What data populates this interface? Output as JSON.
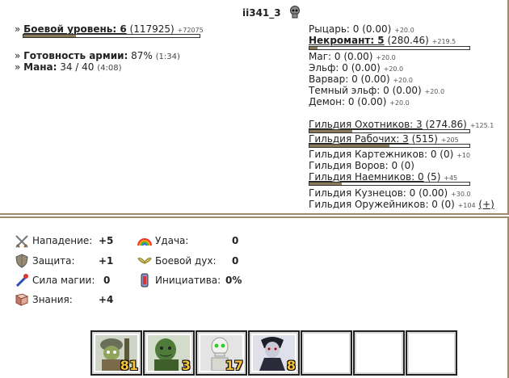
{
  "header": {
    "player_name": "ii341_3"
  },
  "left": {
    "combat_level_label": "Боевой уровень: 6",
    "combat_level_exp": "(117925)",
    "combat_level_gain": "+72075",
    "combat_level_progress": 0.3,
    "army_ready_label": "Готовность армии:",
    "army_ready_value": "87%",
    "army_ready_time": "(1:34)",
    "mana_label": "Мана:",
    "mana_value": "34 / 40",
    "mana_time": "(4:08)"
  },
  "factions": [
    {
      "name": "Рыцарь: 0 (0.00)",
      "gain": "+20.0",
      "bold": false,
      "bar": false
    },
    {
      "name": "Некромант: 5",
      "value": "(280.46)",
      "gain": "+219.5",
      "bold": true,
      "bar": true,
      "progress": 0.05
    },
    {
      "name": "Маг: 0 (0.00)",
      "gain": "+20.0",
      "bold": false,
      "bar": false
    },
    {
      "name": "Эльф: 0 (0.00)",
      "gain": "+20.0",
      "bold": false,
      "bar": false
    },
    {
      "name": "Варвар: 0 (0.00)",
      "gain": "+20.0",
      "bold": false,
      "bar": false
    },
    {
      "name": "Темный эльф: 0 (0.00)",
      "gain": "+20.0",
      "bold": false,
      "bar": false
    },
    {
      "name": "Демон: 0 (0.00)",
      "gain": "+20.0",
      "bold": false,
      "bar": false
    }
  ],
  "guilds": [
    {
      "name": "Гильдия Охотников: 3",
      "value": "(274.86)",
      "gain": "+125.1",
      "link": true,
      "progress": 0.27
    },
    {
      "name": "Гильдия Рабочих: 3",
      "value": "(515)",
      "gain": "+205",
      "link": true,
      "progress": 0.5
    },
    {
      "name": "Гильдия Картежников: 0 (0)",
      "value": "",
      "gain": "+10",
      "link": false
    },
    {
      "name": "Гильдия Воров: 0 (0)",
      "value": "",
      "gain": "",
      "link": false
    },
    {
      "name": "Гильдия Наемников: 0",
      "value": "(5)",
      "gain": "+45",
      "link": true,
      "progress": 0.2
    },
    {
      "name": "Гильдия Кузнецов: 0 (0.00)",
      "value": "",
      "gain": "+30.0",
      "link": false
    },
    {
      "name": "Гильдия Оружейников: 0 (0)",
      "value": "",
      "gain": "+104",
      "link": false,
      "extra": "(+)"
    }
  ],
  "stats": {
    "attack_label": "Нападение:",
    "attack_value": "+5",
    "defense_label": "Защита:",
    "defense_value": "+1",
    "magic_label": "Сила магии:",
    "magic_value": "0",
    "knowledge_label": "Знания:",
    "knowledge_value": "+4",
    "luck_label": "Удача:",
    "luck_value": "0",
    "morale_label": "Боевой дух:",
    "morale_value": "0",
    "initiative_label": "Инициатива:",
    "initiative_value": "0%"
  },
  "army": [
    {
      "unit": "zombie",
      "count": "81"
    },
    {
      "unit": "ghoul",
      "count": "3"
    },
    {
      "unit": "skeleton",
      "count": "17"
    },
    {
      "unit": "vampire",
      "count": "8"
    },
    {
      "unit": "",
      "count": ""
    },
    {
      "unit": "",
      "count": ""
    },
    {
      "unit": "",
      "count": ""
    }
  ],
  "colors": {
    "frame": "#9d8a6a",
    "count": "#f6c23a",
    "bar_fill": "#8a7a5a"
  }
}
